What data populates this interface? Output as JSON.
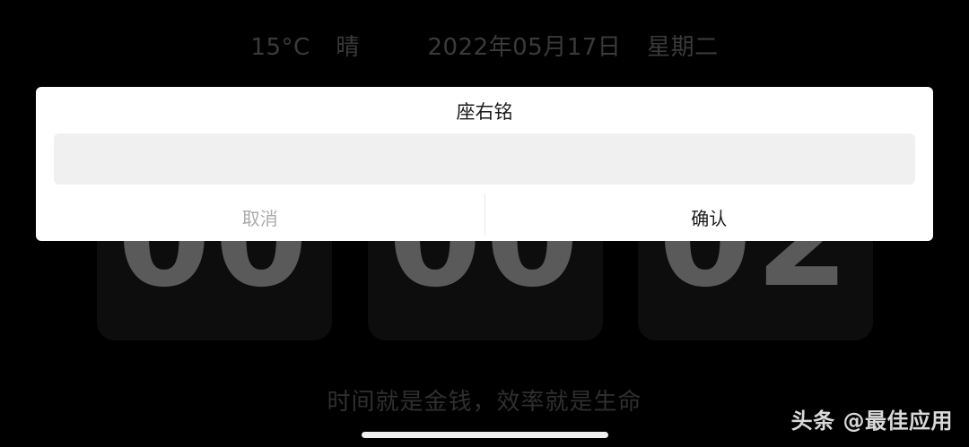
{
  "header": {
    "temperature": "15°C",
    "weather": "晴",
    "date": "2022年05月17日",
    "weekday": "星期二"
  },
  "clock": {
    "hour": "00",
    "minute": "00",
    "second": "02"
  },
  "motto": "时间就是金钱，效率就是生命",
  "dialog": {
    "title": "座右铭",
    "input_value": "",
    "input_placeholder": "",
    "cancel_label": "取消",
    "confirm_label": "确认"
  },
  "watermark": "头条 @最佳应用",
  "colors": {
    "background": "#000000",
    "dialog_bg": "#ffffff",
    "input_bg": "#f0f0f0",
    "card_bg": "#0d0d0d",
    "digit": "#5a5a5a",
    "dim_text": "#3a3a3a",
    "cancel_text": "#aaaaaa"
  }
}
